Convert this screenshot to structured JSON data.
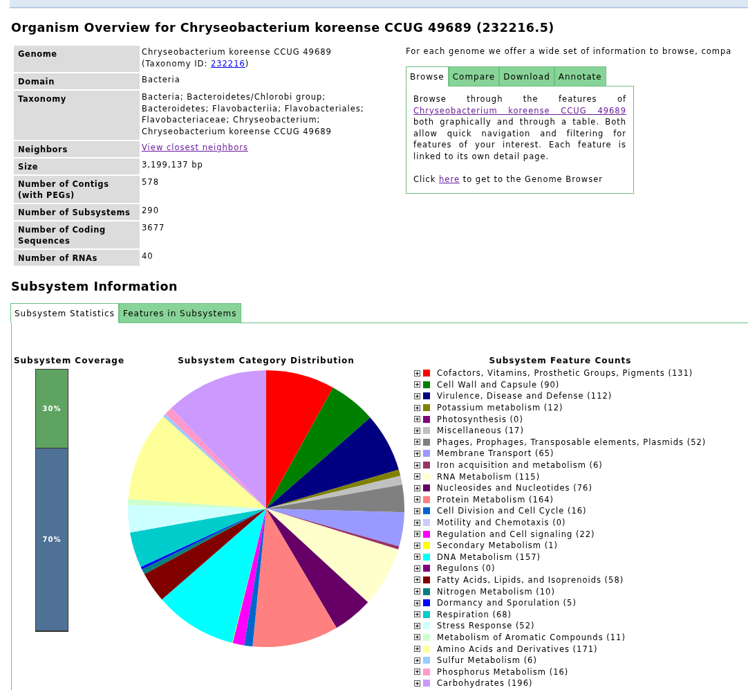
{
  "page_title": "Organism Overview for Chryseobacterium koreense CCUG 49689 (232216.5)",
  "overview": {
    "rows": [
      {
        "label": "Genome",
        "kind": "genome",
        "value": "Chryseobacterium koreense CCUG 49689",
        "prefix": "(Taxonomy ID: ",
        "link": "232216",
        "suffix": ")",
        "visited": false
      },
      {
        "label": "Domain",
        "kind": "text",
        "value": "Bacteria"
      },
      {
        "label": "Taxonomy",
        "kind": "text",
        "value": "Bacteria; Bacteroidetes/Chlorobi group; Bacteroidetes; Flavobacteriia; Flavobacteriales; Flavobacteriaceae; Chryseobacterium; Chryseobacterium koreense CCUG 49689"
      },
      {
        "label": "Neighbors",
        "kind": "link",
        "value": "View closest neighbors",
        "visited": true
      },
      {
        "label": "Size",
        "kind": "text",
        "value": "3,199,137 bp"
      },
      {
        "label": "Number of Contigs (with PEGs)",
        "kind": "text",
        "value": "578"
      },
      {
        "label": "Number of Subsystems",
        "kind": "text",
        "value": "290"
      },
      {
        "label": "Number of Coding Sequences",
        "kind": "text",
        "value": "3677"
      },
      {
        "label": "Number of RNAs",
        "kind": "text",
        "value": "40"
      }
    ]
  },
  "intro": "For each genome we offer a wide set of information to browse, compa",
  "info_tabs": [
    {
      "label": "Browse",
      "selected": true
    },
    {
      "label": "Compare",
      "selected": false
    },
    {
      "label": "Download",
      "selected": false
    },
    {
      "label": "Annotate",
      "selected": false
    }
  ],
  "info_panel": {
    "lead": "Browse through the features of",
    "organism_link": "Chryseobacterium koreense CCUG 49689",
    "rest": "both graphically and through a table. Both allow quick navigation and filtering for features of your interest. Each feature is linked to its own detail page.",
    "click_prefix": "Click ",
    "click_link": "here",
    "click_suffix": " to get to the Genome Browser"
  },
  "section_title": "Subsystem Information",
  "subsystem_tabs": [
    {
      "label": "Subsystem Statistics",
      "selected": true
    },
    {
      "label": "Features in Subsystems",
      "selected": false
    }
  ],
  "coverage": {
    "title": "Subsystem Coverage",
    "segments": [
      {
        "kind": "covered",
        "label": "30%",
        "level": 0.3
      },
      {
        "kind": "uncovered",
        "label": "70%",
        "level": 0.7
      }
    ]
  },
  "distribution": {
    "title": "Subsystem Category Distribution",
    "chart_data": {
      "type": "pie",
      "values": [
        8.04,
        5.52,
        6.88,
        0.74,
        0,
        1.04,
        3.19,
        3.99,
        0.37,
        7.06,
        4.67,
        10.07,
        0.98,
        0,
        1.35,
        0.06,
        9.64,
        0,
        3.56,
        0.61,
        0.31,
        4.17,
        3.19,
        0.68,
        10.5,
        0.37,
        0.98,
        12.03
      ]
    }
  },
  "feature_counts": {
    "title": "Subsystem Feature Counts",
    "items": [
      {
        "label": "Cofactors, Vitamins, Prosthetic Groups, Pigments (131)",
        "color": "#ff0000",
        "expanded": false
      },
      {
        "label": "Cell Wall and Capsule (90)",
        "color": "#008000",
        "expanded": false
      },
      {
        "label": "Virulence, Disease and Defense (112)",
        "color": "#000080",
        "expanded": false
      },
      {
        "label": "Potassium metabolism (12)",
        "color": "#808000",
        "expanded": false
      },
      {
        "label": "Photosynthesis (0)",
        "color": "#800080",
        "expanded": false
      },
      {
        "label": "Miscellaneous (17)",
        "color": "#c0c0c0",
        "expanded": false
      },
      {
        "label": "Phages, Prophages, Transposable elements, Plasmids (52)",
        "color": "#808080",
        "expanded": false
      },
      {
        "label": "Membrane Transport (65)",
        "color": "#9999ff",
        "expanded": false
      },
      {
        "label": "Iron acquisition and metabolism (6)",
        "color": "#993366",
        "expanded": false
      },
      {
        "label": "RNA Metabolism (115)",
        "color": "#ffffcc",
        "expanded": false
      },
      {
        "label": "Nucleosides and Nucleotides (76)",
        "color": "#660066",
        "expanded": false
      },
      {
        "label": "Protein Metabolism (164)",
        "color": "#ff8080",
        "expanded": false
      },
      {
        "label": "Cell Division and Cell Cycle (16)",
        "color": "#0066cc",
        "expanded": false
      },
      {
        "label": "Motility and Chemotaxis (0)",
        "color": "#ccccff",
        "expanded": false
      },
      {
        "label": "Regulation and Cell signaling (22)",
        "color": "#ff00ff",
        "expanded": false
      },
      {
        "label": "Secondary Metabolism (1)",
        "color": "#ffff00",
        "expanded": false
      },
      {
        "label": "DNA Metabolism (157)",
        "color": "#00ffff",
        "expanded": false
      },
      {
        "label": "Regulons (0)",
        "color": "#800080",
        "expanded": false
      },
      {
        "label": "Fatty Acids, Lipids, and Isoprenoids (58)",
        "color": "#800000",
        "expanded": false
      },
      {
        "label": "Nitrogen Metabolism (10)",
        "color": "#008080",
        "expanded": false
      },
      {
        "label": "Dormancy and Sporulation (5)",
        "color": "#0000ff",
        "expanded": false
      },
      {
        "label": "Respiration (68)",
        "color": "#00cccc",
        "expanded": false
      },
      {
        "label": "Stress Response (52)",
        "color": "#ccffff",
        "expanded": false
      },
      {
        "label": "Metabolism of Aromatic Compounds (11)",
        "color": "#ccffcc",
        "expanded": false
      },
      {
        "label": "Amino Acids and Derivatives (171)",
        "color": "#ffff99",
        "expanded": false
      },
      {
        "label": "Sulfur Metabolism (6)",
        "color": "#99ccff",
        "expanded": false
      },
      {
        "label": "Phosphorus Metabolism (16)",
        "color": "#ff99cc",
        "expanded": false
      },
      {
        "label": "Carbohydrates (196)",
        "color": "#cc99ff",
        "expanded": false
      }
    ]
  }
}
